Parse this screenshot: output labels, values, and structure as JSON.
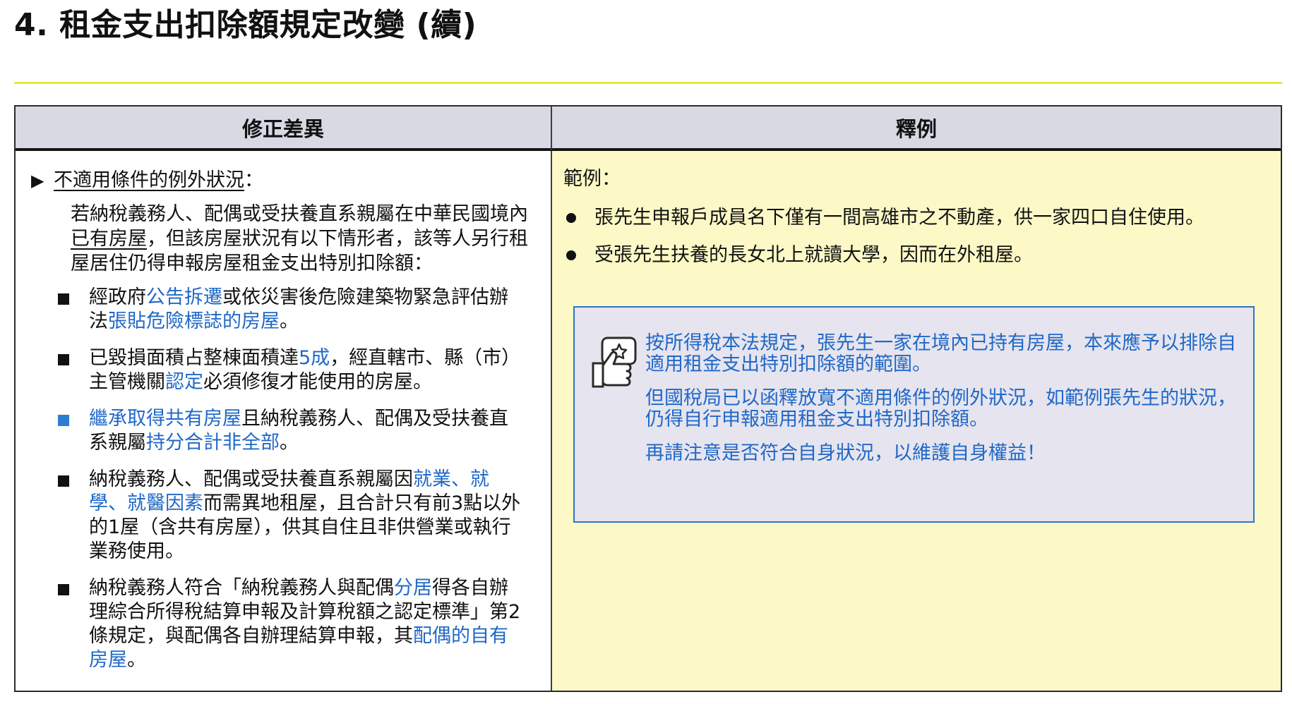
{
  "title": "4. 租金支出扣除額規定改變 (續)",
  "table": {
    "left_header": "修正差異",
    "right_header": "釋例"
  },
  "left_panel": {
    "section_marker": "▶",
    "section_title": "不適用條件的例外狀況",
    "section_title_suffix": "：",
    "intro_parts": [
      "若納稅義務人、配偶或受扶養直系親屬在中華民國境內",
      "已有房屋",
      "，但該房屋狀況有以下情形者，該等人另行租屋居住仍得申報房屋租金支出特別扣除額："
    ],
    "items": [
      {
        "marker_color": "#111111",
        "parts": [
          {
            "text": "經政府",
            "highlight": false
          },
          {
            "text": "公告拆遷",
            "highlight": true
          },
          {
            "text": "或依災害後危險建築物緊急評估辦法",
            "highlight": false
          },
          {
            "text": "張貼危險標誌的房屋",
            "highlight": true
          },
          {
            "text": "。",
            "highlight": false
          }
        ]
      },
      {
        "marker_color": "#111111",
        "parts": [
          {
            "text": "已毀損面積占整棟面積達",
            "highlight": false
          },
          {
            "text": "5成",
            "highlight": true
          },
          {
            "text": "，經直轄市、縣（市）主管機關",
            "highlight": false
          },
          {
            "text": "認定",
            "highlight": true
          },
          {
            "text": "必須修復才能使用的房屋。",
            "highlight": false
          }
        ]
      },
      {
        "marker_color": "#2d7ed3",
        "parts": [
          {
            "text": "繼承取得共有房屋",
            "highlight": true
          },
          {
            "text": "且納稅義務人、配偶及受扶養直系親屬",
            "highlight": false
          },
          {
            "text": "持分合計非全部",
            "highlight": true
          },
          {
            "text": "。",
            "highlight": false
          }
        ]
      },
      {
        "marker_color": "#111111",
        "parts": [
          {
            "text": "納稅義務人、配偶或受扶養直系親屬因",
            "highlight": false
          },
          {
            "text": "就業、就學、就醫因素",
            "highlight": true
          },
          {
            "text": "而需異地租屋，且合計只有前3點以外的1屋（含共有房屋），供其自住且非供營業或執行業務使用。",
            "highlight": false
          }
        ]
      },
      {
        "marker_color": "#111111",
        "parts": [
          {
            "text": "納稅義務人符合「納稅義務人與配偶",
            "highlight": false
          },
          {
            "text": "分居",
            "highlight": true
          },
          {
            "text": "得各自辦理綜合所得稅結算申報及計算稅額之認定標準」第2條規定，與配偶各自辦理結算申報，其",
            "highlight": false
          },
          {
            "text": "配偶的自有房屋",
            "highlight": true
          },
          {
            "text": "。",
            "highlight": false
          }
        ]
      }
    ]
  },
  "right_panel": {
    "example_title": "範例：",
    "examples": [
      "張先生申報戶成員名下僅有一間高雄市之不動產，供一家四口自住使用。",
      "受張先生扶養的長女北上就讀大學，因而在外租屋。"
    ],
    "note_icon": "thumbs-up-speech-icon",
    "note_paragraphs": [
      "按所得稅本法規定，張先生一家在境內已持有房屋，本來應予以排除自適用租金支出特別扣除額的範圍。",
      "但國稅局已以函釋放寬不適用條件的例外狀況，如範例張先生的狀況，仍得自行申報適用租金支出特別扣除額。",
      "再請注意是否符合自身狀況，以維護自身權益！"
    ]
  },
  "colors": {
    "title_rule": "#e9e63a",
    "header_background": "#d7d9e3",
    "example_background": "#fdf9c7",
    "note_background": "#e6e4ee",
    "accent_blue": "#1f68c8"
  }
}
